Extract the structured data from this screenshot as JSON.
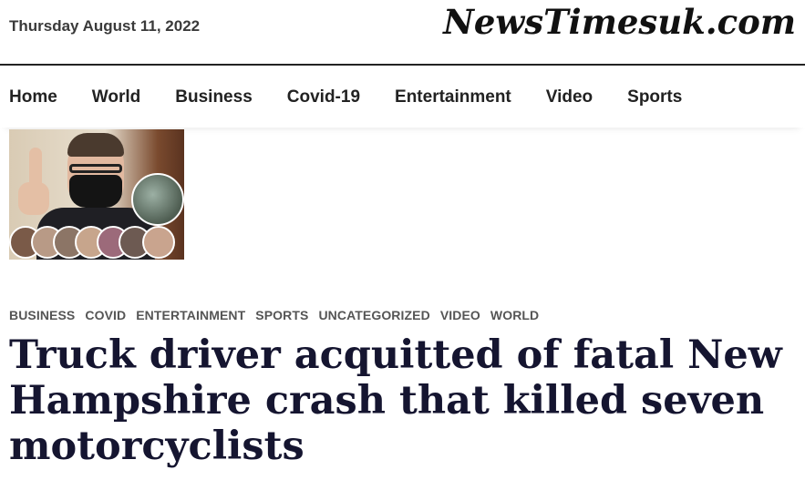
{
  "header": {
    "date": "Thursday August 11, 2022",
    "logo": "NewsTimesuk.com"
  },
  "nav": {
    "items": [
      "Home",
      "World",
      "Business",
      "Covid-19",
      "Entertainment",
      "Video",
      "Sports"
    ]
  },
  "article": {
    "image_alt": "Truck driver in courtroom with mask and victims photos",
    "categories": [
      "BUSINESS",
      "COVID",
      "ENTERTAINMENT",
      "SPORTS",
      "UNCATEGORIZED",
      "VIDEO",
      "WORLD"
    ],
    "headline": "Truck driver acquitted of fatal New Hampshire crash that killed seven motorcyclists"
  },
  "colors": {
    "text": "#111111",
    "headline": "#151530",
    "category": "#555555",
    "divider": "#222222"
  }
}
